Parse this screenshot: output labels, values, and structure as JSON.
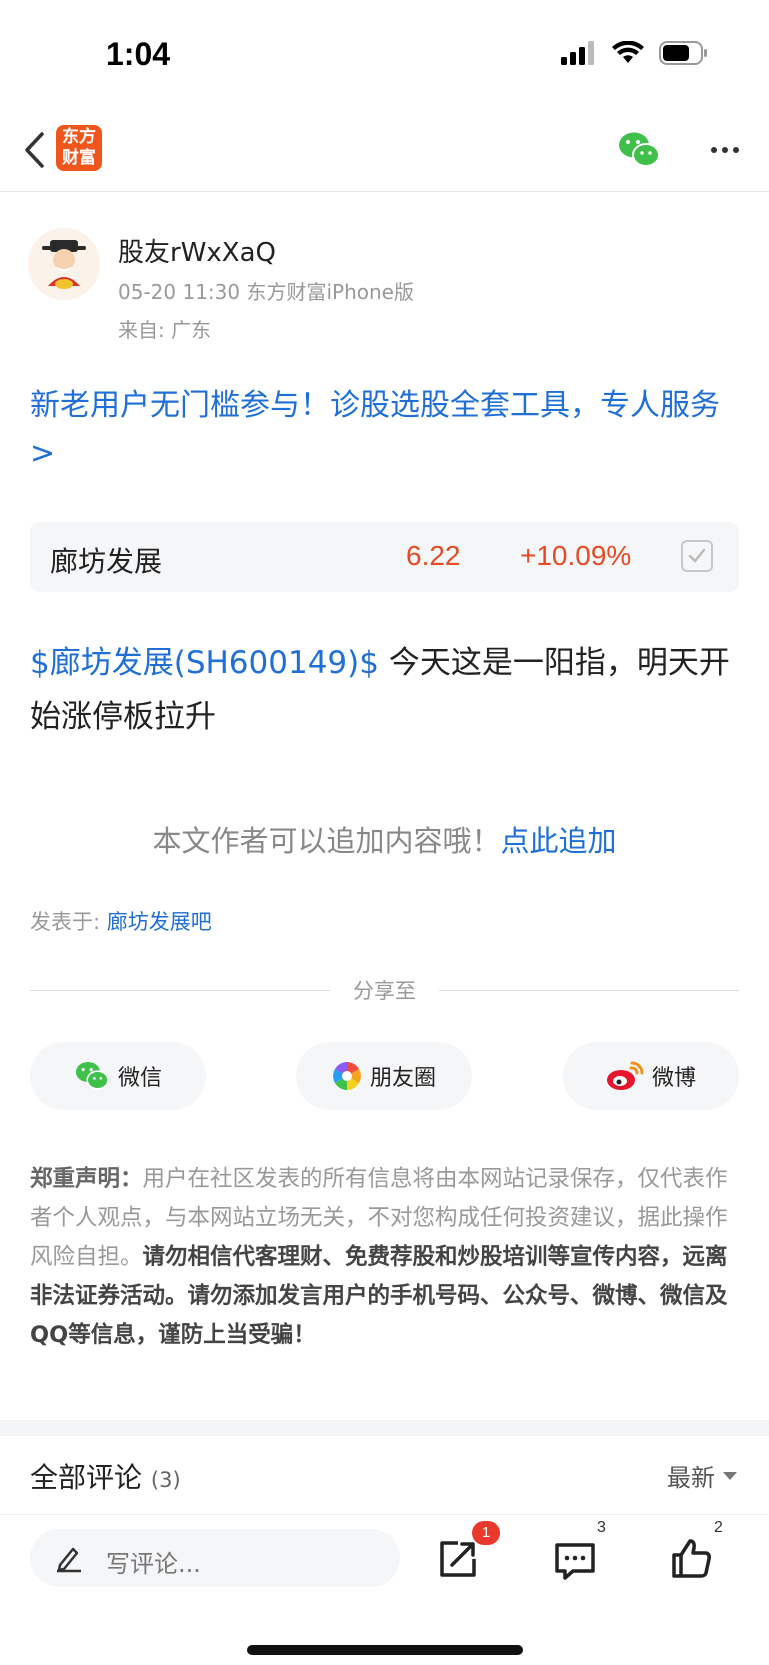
{
  "status_bar": {
    "time": "1:04"
  },
  "nav": {
    "logo_line1": "东方",
    "logo_line2": "财富"
  },
  "author": {
    "name": "股友rWxXaQ",
    "meta": "05-20 11:30 东方财富iPhone版",
    "location": "来自: 广东"
  },
  "promo": {
    "text": "新老用户无门槛参与！诊股选股全套工具，专人服务>"
  },
  "stock": {
    "name": "廊坊发展",
    "price": "6.22",
    "change": "+10.09%"
  },
  "post": {
    "tag": "$廊坊发展(SH600149)$",
    "text": " 今天这是一阳指，明天开始涨停板拉升"
  },
  "append": {
    "prompt": "本文作者可以追加内容哦！",
    "link": "点此追加"
  },
  "posted_in": {
    "label": "发表于: ",
    "bar": "廊坊发展吧"
  },
  "share": {
    "label": "分享至",
    "wechat": "微信",
    "moments": "朋友圈",
    "weibo": "微博"
  },
  "disclaimer": {
    "head": "郑重声明：",
    "body": "用户在社区发表的所有信息将由本网站记录保存，仅代表作者个人观点，与本网站立场无关，不对您构成任何投资建议，据此操作风险自担。",
    "warning": "请勿相信代客理财、免费荐股和炒股培训等宣传内容，远离非法证券活动。请勿添加发言用户的手机号码、公众号、微博、微信及QQ等信息，谨防上当受骗！"
  },
  "comments": {
    "title": "全部评论",
    "count": "(3)",
    "sort": "最新"
  },
  "bottom_bar": {
    "placeholder": "写评论...",
    "share_badge": "1",
    "comment_count": "3",
    "like_count": "2"
  },
  "colors": {
    "link_blue": "#1f6fd6",
    "price_red": "#e44b25",
    "brand_orange": "#f0551c"
  }
}
